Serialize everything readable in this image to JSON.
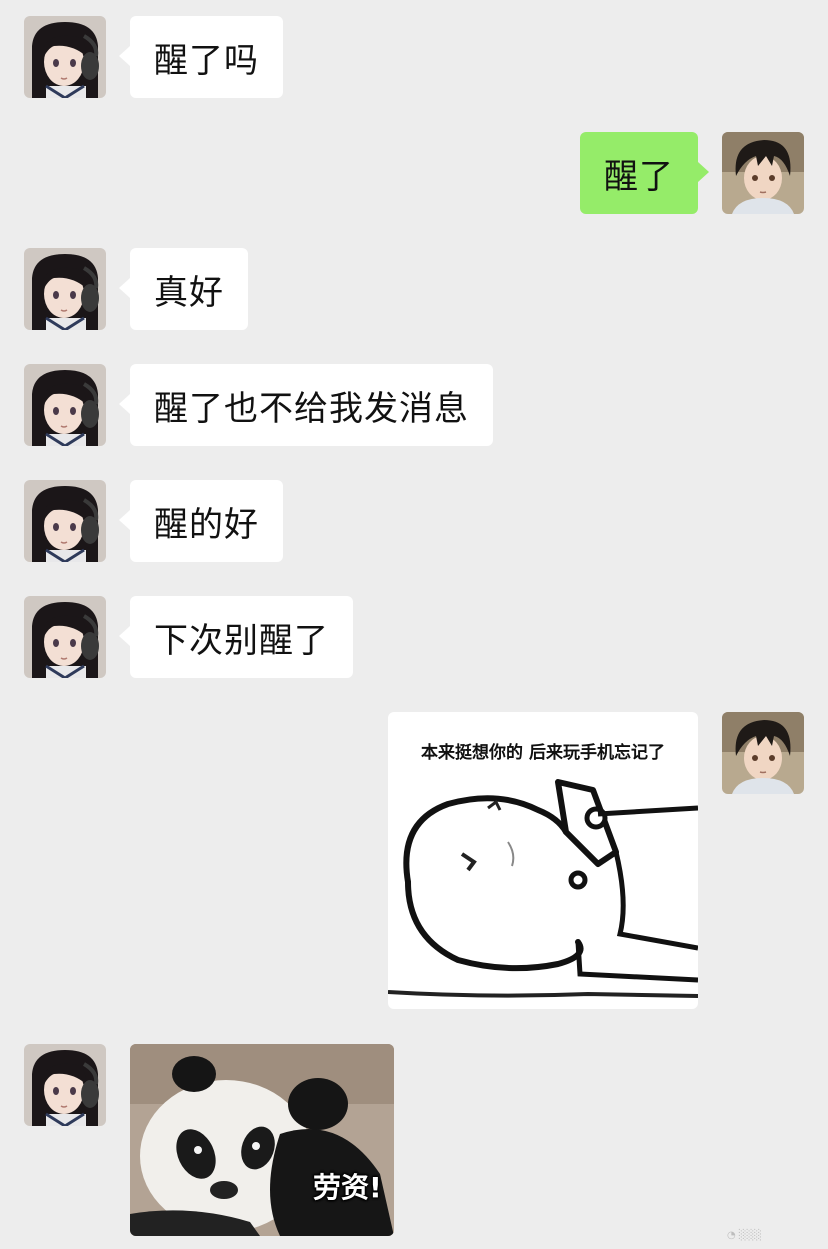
{
  "messages": [
    {
      "sender": "friend",
      "text": "醒了吗"
    },
    {
      "sender": "me",
      "text": "醒了"
    },
    {
      "sender": "friend",
      "text": "真好"
    },
    {
      "sender": "friend",
      "text": "醒了也不给我发消息"
    },
    {
      "sender": "friend",
      "text": "醒的好"
    },
    {
      "sender": "friend",
      "text": "下次别醒了"
    },
    {
      "sender": "me",
      "type": "sticker",
      "caption": "本来挺想你的 后来玩手机忘记了"
    },
    {
      "sender": "friend",
      "type": "sticker",
      "caption": "劳资!"
    }
  ],
  "avatars": {
    "friend": {
      "icon": "anime-girl-headphones-avatar",
      "hair": "#1b1618",
      "skin": "#f3dfd4",
      "headphones": "#3a3a3a"
    },
    "me": {
      "icon": "anime-boy-avatar",
      "hair": "#1f1a17",
      "skin": "#f0d6c3",
      "shirt": "#dfe4ea"
    }
  },
  "colors": {
    "background": "#ededed",
    "incoming_bubble": "#ffffff",
    "outgoing_bubble": "#95ec69",
    "text": "#111111"
  }
}
